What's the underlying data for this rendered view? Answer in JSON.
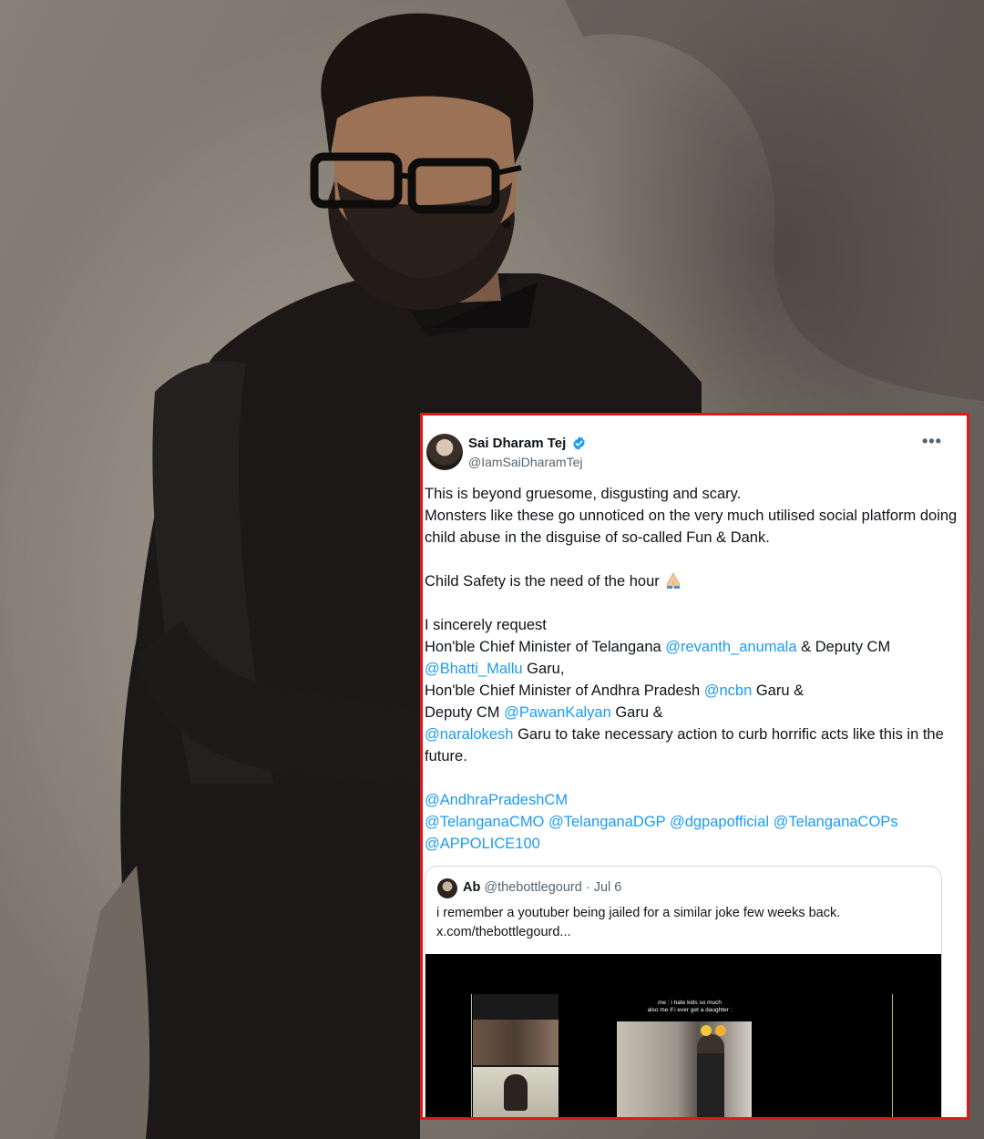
{
  "tweet": {
    "author_name": "Sai Dharam Tej",
    "author_handle": "@IamSaiDharamTej",
    "more_icon": "more-dots-icon",
    "verified_color": "#1d9bf0",
    "line1": "This is beyond gruesome, disgusting and scary.",
    "line2": "Monsters like these go unnoticed on the very much utilised social platform doing child abuse in the disguise of so-called Fun & Dank.",
    "line3": "Child Safety is the need of the hour",
    "line4": "I sincerely request",
    "line5_text": "Hon'ble Chief Minister of Telangana ",
    "mention1": "@revanth_anumala",
    "line5_text2": " & Deputy CM ",
    "mention2": "@Bhatti_Mallu",
    "line5_text3": " Garu,",
    "line6_text": "Hon'ble Chief Minister of Andhra Pradesh ",
    "mention3": "@ncbn",
    "line6_text2": " Garu &",
    "line7_text": "Deputy CM ",
    "mention4": "@PawanKalyan",
    "line7_text2": " Garu &",
    "mention5": "@naralokesh",
    "line8_text": " Garu to take necessary action to curb horrific acts like this in the future.",
    "mention6": "@AndhraPradeshCM",
    "mention7": "@TelanganaCMO",
    "mention8": "@TelanganaDGP",
    "mention9": "@dgpapofficial",
    "mention10": "@TelanganaCOPs",
    "mention11": "@APPOLICE100"
  },
  "quote": {
    "name": "Ab",
    "handle": "@thebottlegourd",
    "date": "· Jul 6",
    "text": "i remember a youtuber being jailed for a similar joke few weeks back.",
    "link": "x.com/thebottlegourd...",
    "meme_line1": "me : i hate kids so much",
    "meme_line2": "also me if i ever get a daughter :"
  }
}
